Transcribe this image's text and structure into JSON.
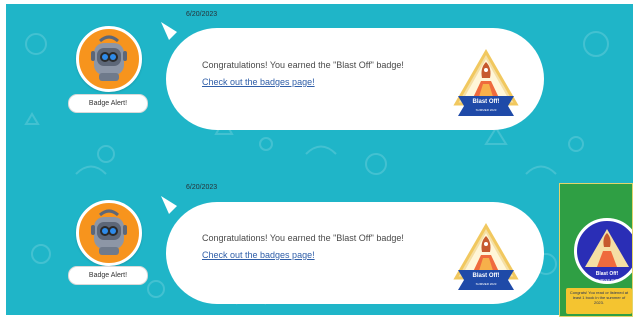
{
  "notifications": [
    {
      "date": "6/20/2023",
      "alert_label": "Badge Alert!",
      "message": "Congratulations! You earned the \"Blast Off\" badge!",
      "link_text": "Check out the badges page!",
      "badge": {
        "title": "Blast Off!",
        "subtitle": "SUMMER 2023"
      }
    },
    {
      "date": "6/20/2023",
      "alert_label": "Badge Alert!",
      "message": "Congratulations! You earned the \"Blast Off\" badge!",
      "link_text": "Check out the badges page!",
      "badge": {
        "title": "Blast Off!",
        "subtitle": "SUMMER 2023"
      }
    }
  ],
  "mini_card": {
    "badge_title": "Blast Off!",
    "badge_subtitle": "SUMMER 2023",
    "message": "Congrats! You read or listened at least 1 book in the summer of 2023."
  },
  "colors": {
    "background": "#1fb5c8",
    "bubble": "#ffffff",
    "avatar_ring": "#f7941d",
    "link": "#2f5ea8",
    "badge_blue": "#1f4aa8",
    "mini_card_bg": "#2f9f44",
    "mini_card_circle": "#2a2eb6",
    "mini_card_box": "#f4c430"
  },
  "icons": {
    "avatar": "robot-avatar-icon",
    "badge": "rocket-badge-icon"
  }
}
